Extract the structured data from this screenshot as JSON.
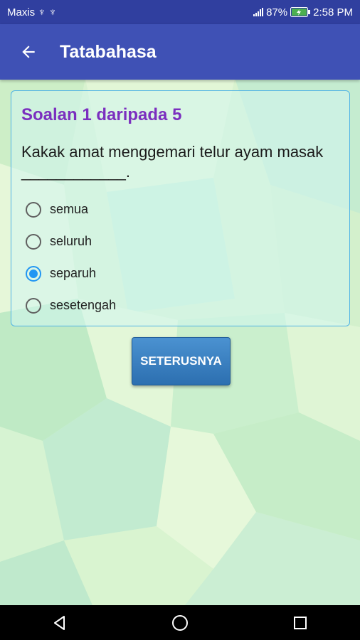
{
  "status_bar": {
    "carrier": "Maxis",
    "usb_icons": [
      "usb-icon",
      "usb-icon"
    ],
    "battery": "87%",
    "time": "2:58 PM"
  },
  "app_bar": {
    "title": "Tatabahasa",
    "color": "#3f51b5",
    "status_color": "#303f9f"
  },
  "question": {
    "heading": "Soalan 1 daripada 5",
    "text": "Kakak amat menggemari telur ayam masak ____________.",
    "options": [
      {
        "label": "semua",
        "selected": false
      },
      {
        "label": "seluruh",
        "selected": false
      },
      {
        "label": "separuh",
        "selected": true
      },
      {
        "label": "sesetengah",
        "selected": false
      }
    ],
    "heading_color": "#7b2fbf"
  },
  "next_button": {
    "label": "SETERUSNYA"
  },
  "nav_bar": {
    "icons": [
      "back-triangle-icon",
      "home-circle-icon",
      "recents-square-icon"
    ]
  }
}
